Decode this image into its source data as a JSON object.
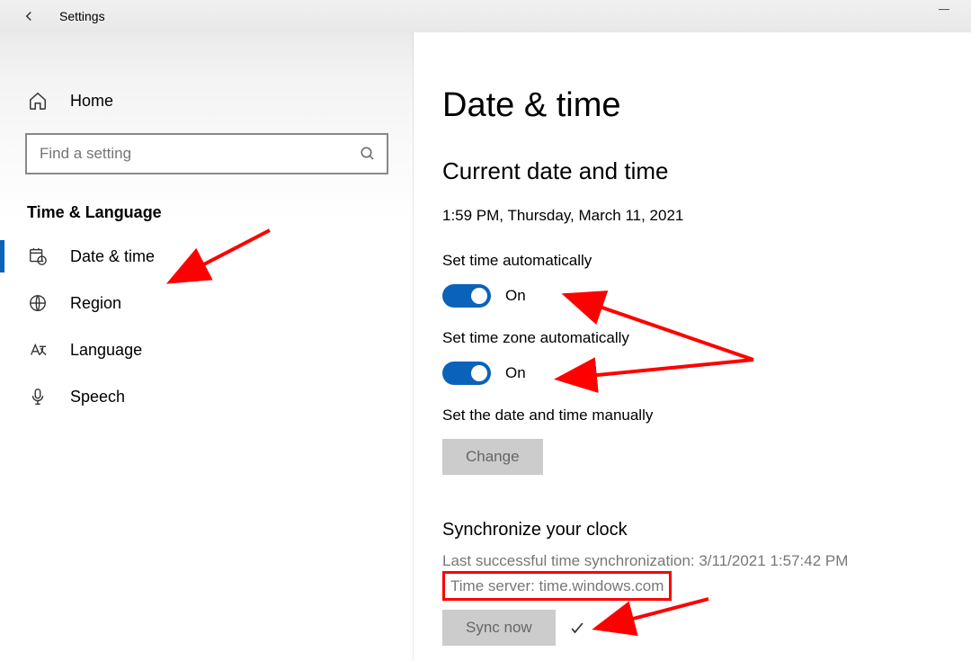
{
  "titlebar": {
    "title": "Settings"
  },
  "sidebar": {
    "home_label": "Home",
    "search_placeholder": "Find a setting",
    "category": "Time & Language",
    "items": [
      {
        "label": "Date & time",
        "active": true
      },
      {
        "label": "Region"
      },
      {
        "label": "Language"
      },
      {
        "label": "Speech"
      }
    ]
  },
  "main": {
    "heading": "Date & time",
    "current_heading": "Current date and time",
    "current_value": "1:59 PM, Thursday, March 11, 2021",
    "set_time_auto_label": "Set time automatically",
    "set_time_auto_state": "On",
    "set_tz_auto_label": "Set time zone automatically",
    "set_tz_auto_state": "On",
    "manual_label": "Set the date and time manually",
    "change_button": "Change",
    "sync_heading": "Synchronize your clock",
    "last_sync": "Last successful time synchronization: 3/11/2021 1:57:42 PM",
    "time_server": "Time server: time.windows.com",
    "sync_button": "Sync now"
  }
}
